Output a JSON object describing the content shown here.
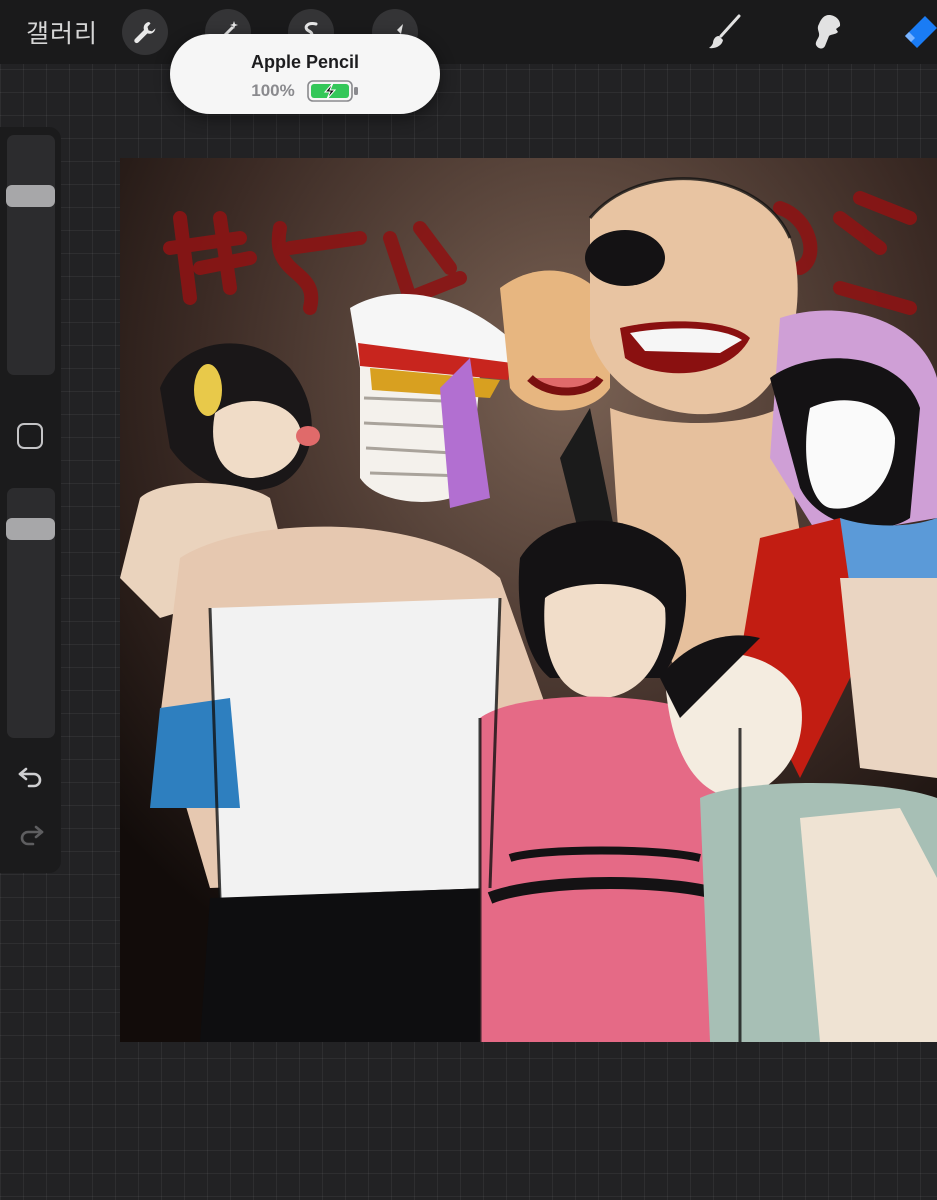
{
  "toolbar": {
    "gallery_label": "갤러리",
    "left_tools": [
      "wrench-icon",
      "magic-wand-icon",
      "selection-icon",
      "transform-icon"
    ],
    "right_tools": [
      "brush-icon",
      "smudge-icon",
      "eraser-icon"
    ],
    "active_tool": "eraser",
    "accent_color": "#1a7cf5"
  },
  "pencil_popup": {
    "title": "Apple Pencil",
    "battery_percent": "100%",
    "battery_level": 1.0,
    "battery_color": "#34c759"
  },
  "sidebar": {
    "brush_size_level": 0.09,
    "brush_opacity_level": 0.0,
    "modifier_icon": "square-icon",
    "undo_icon": "undo-icon",
    "redo_icon": "redo-icon"
  },
  "canvas": {
    "background_text_left": "",
    "background_text_right": ""
  }
}
